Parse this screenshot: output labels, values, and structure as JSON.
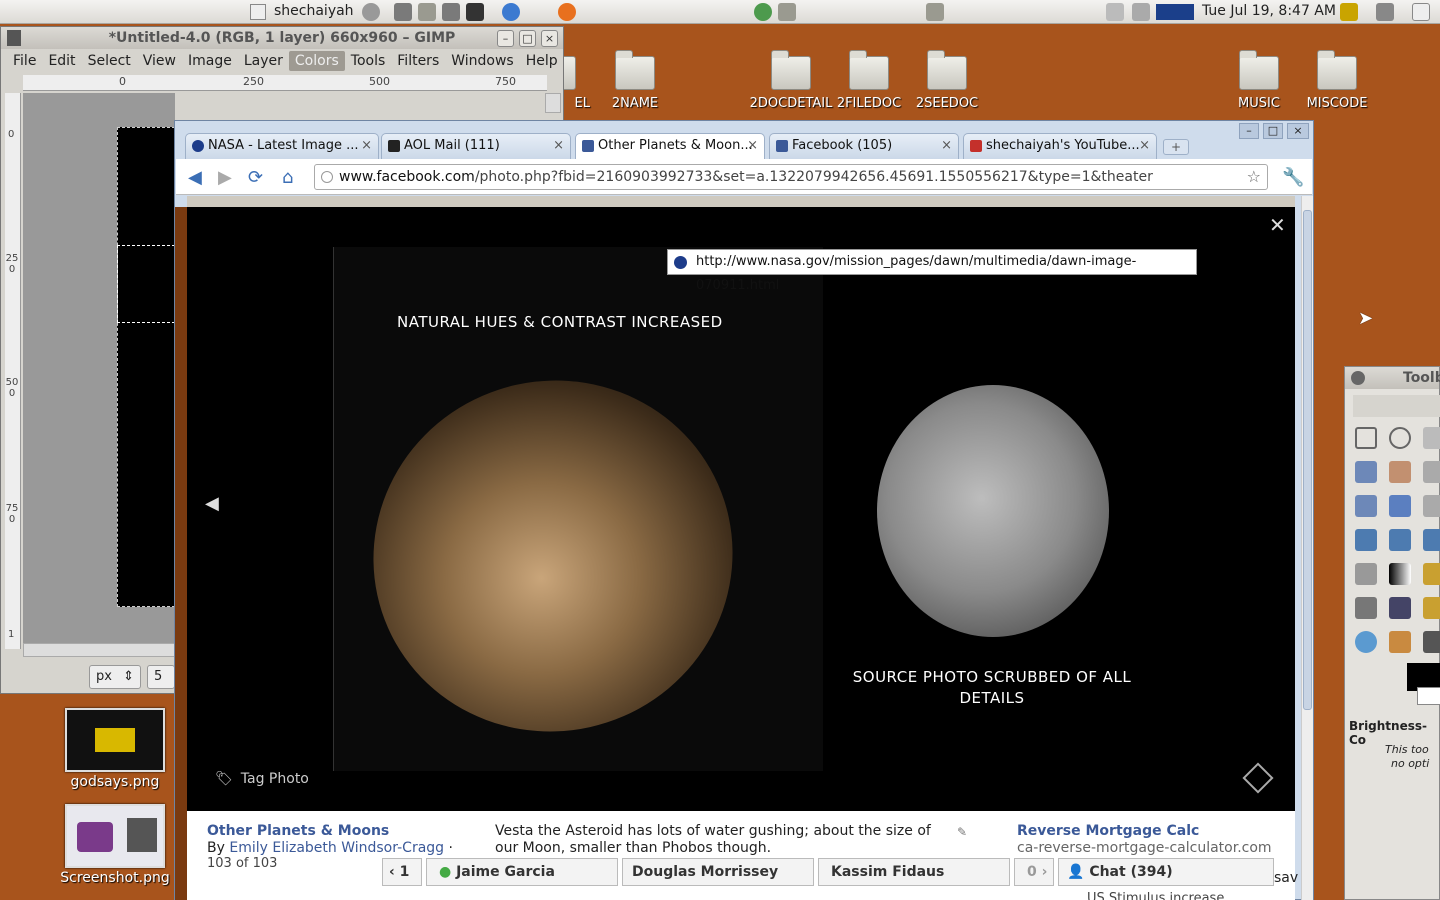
{
  "panel": {
    "user": "shechaiyah",
    "clock": "Tue Jul 19,  8:47 AM"
  },
  "desktop": {
    "folders": [
      "EL",
      "2NAME",
      "2DOCDETAIL",
      "2FILEDOC",
      "2SEEDOC",
      "MUSIC",
      "MISCODE"
    ],
    "files": [
      "godsays.png",
      "Screenshot.png"
    ]
  },
  "gimp": {
    "title": "*Untitled-4.0 (RGB, 1 layer) 660x960 – GIMP",
    "menu": [
      "File",
      "Edit",
      "Select",
      "View",
      "Image",
      "Layer",
      "Colors",
      "Tools",
      "Filters",
      "Windows",
      "Help"
    ],
    "ruler_ticks": [
      "0",
      "250",
      "500",
      "750"
    ],
    "vruler_ticks": [
      "0",
      "250",
      "500",
      "750",
      "1"
    ],
    "unit": "px",
    "zoom_partial": "5"
  },
  "browser": {
    "tabs": [
      "NASA - Latest Image ...",
      "AOL Mail (111)",
      "Other Planets & Moon...",
      "Facebook (105)",
      "shechaiyah's YouTube..."
    ],
    "url_host": "www.facebook.com",
    "url_path": "/photo.php?fbid=2160903992733&set=a.1322079942656.45691.1550556217&type=1&theater"
  },
  "photo": {
    "source_url": "http://www.nasa.gov/mission_pages/dawn/multimedia/dawn-image-070911.html",
    "caption_left": "NATURAL HUES & CONTRAST INCREASED",
    "caption_right": "SOURCE PHOTO SCRUBBED OF ALL DETAILS",
    "tag_label": "Tag Photo",
    "album": "Other Planets & Moons",
    "by": "By",
    "author": "Emily Elizabeth Windsor-Cragg",
    "sep": "·",
    "count": "103 of 103",
    "description": "Vesta the Asteroid has lots of water gushing; about the size of our Moon, smaller than Phobos though.",
    "ad_title": "Reverse Mortgage Calc",
    "ad_url": "ca-reverse-mortgage-calculator.com",
    "ad_more": "US Stimulus increase"
  },
  "chatbar": {
    "left_count": "1",
    "people": [
      "Jaime Garcia",
      "Douglas Morrissey",
      "Kassim Fidaus"
    ],
    "right_count": "0",
    "chat": "Chat (394)",
    "partial": "sav"
  },
  "toolbox": {
    "title": "Toolb",
    "brightness": "Brightness-Co",
    "note1": "This too",
    "note2": "no opti"
  }
}
